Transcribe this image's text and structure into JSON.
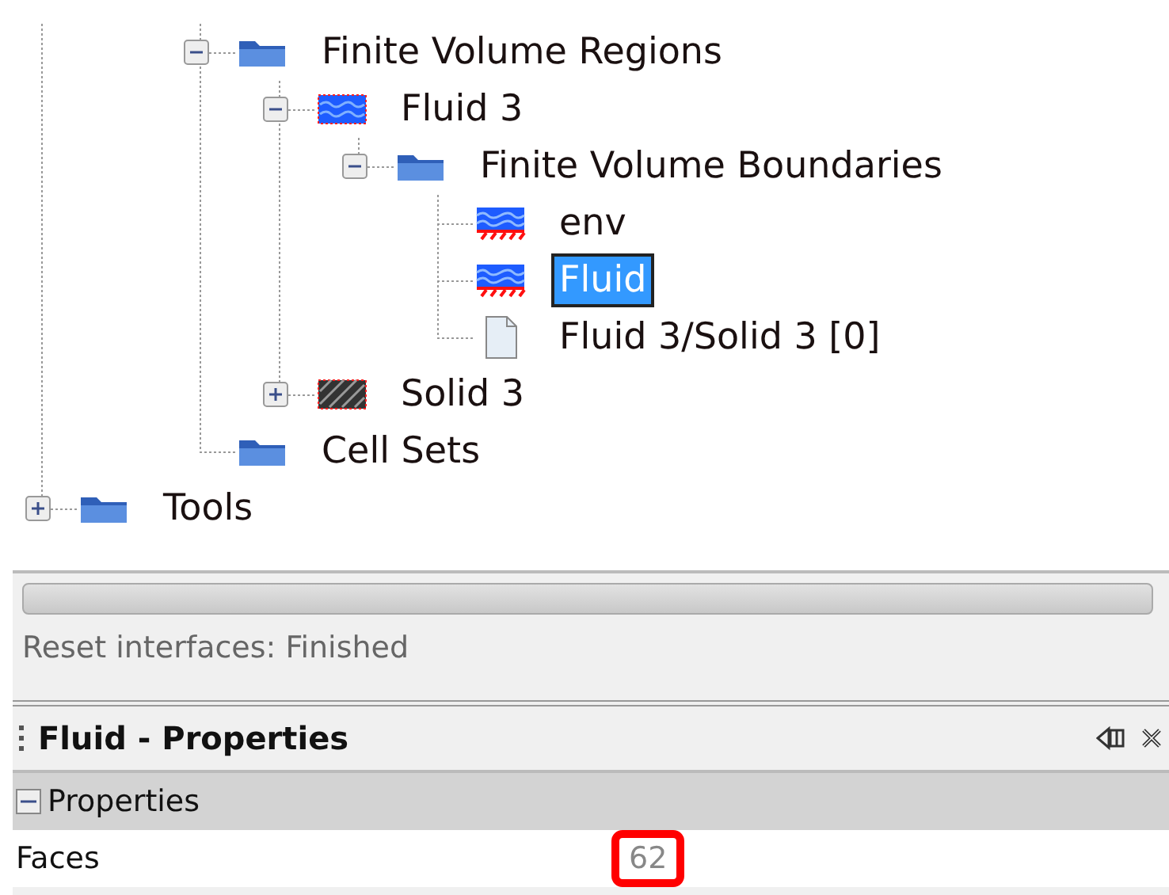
{
  "tree": [
    {
      "children": [
        {
          "children": [
            {
              "label": "Finite Volume Regions",
              "kind": "folder",
              "expanded": true,
              "selected": false,
              "children": [
                {
                  "label": "Fluid 3",
                  "kind": "fluid",
                  "expanded": true,
                  "selected": false,
                  "children": [
                    {
                      "label": "Finite Volume Boundaries",
                      "kind": "folder",
                      "expanded": true,
                      "selected": false,
                      "children": [
                        {
                          "label": "env",
                          "kind": "boundary",
                          "selected": false
                        },
                        {
                          "label": "Fluid",
                          "kind": "boundary",
                          "selected": true
                        },
                        {
                          "label": "Fluid 3/Solid 3 [0]",
                          "kind": "document",
                          "selected": false
                        }
                      ]
                    }
                  ]
                },
                {
                  "label": "Solid 3",
                  "kind": "solid",
                  "expanded": false,
                  "selected": false
                }
              ]
            },
            {
              "label": "Cell Sets",
              "kind": "folder",
              "selected": false
            }
          ]
        }
      ]
    },
    {
      "label": "Tools",
      "kind": "folder",
      "expanded": false,
      "selected": false
    }
  ],
  "progress": {
    "level": 0
  },
  "status": "Reset interfaces: Finished",
  "panel": {
    "title": "Fluid - Properties",
    "group": {
      "label": "Properties",
      "expanded": true
    },
    "rows": [
      {
        "name": "Faces",
        "value": "62",
        "highlighted": true
      }
    ]
  }
}
